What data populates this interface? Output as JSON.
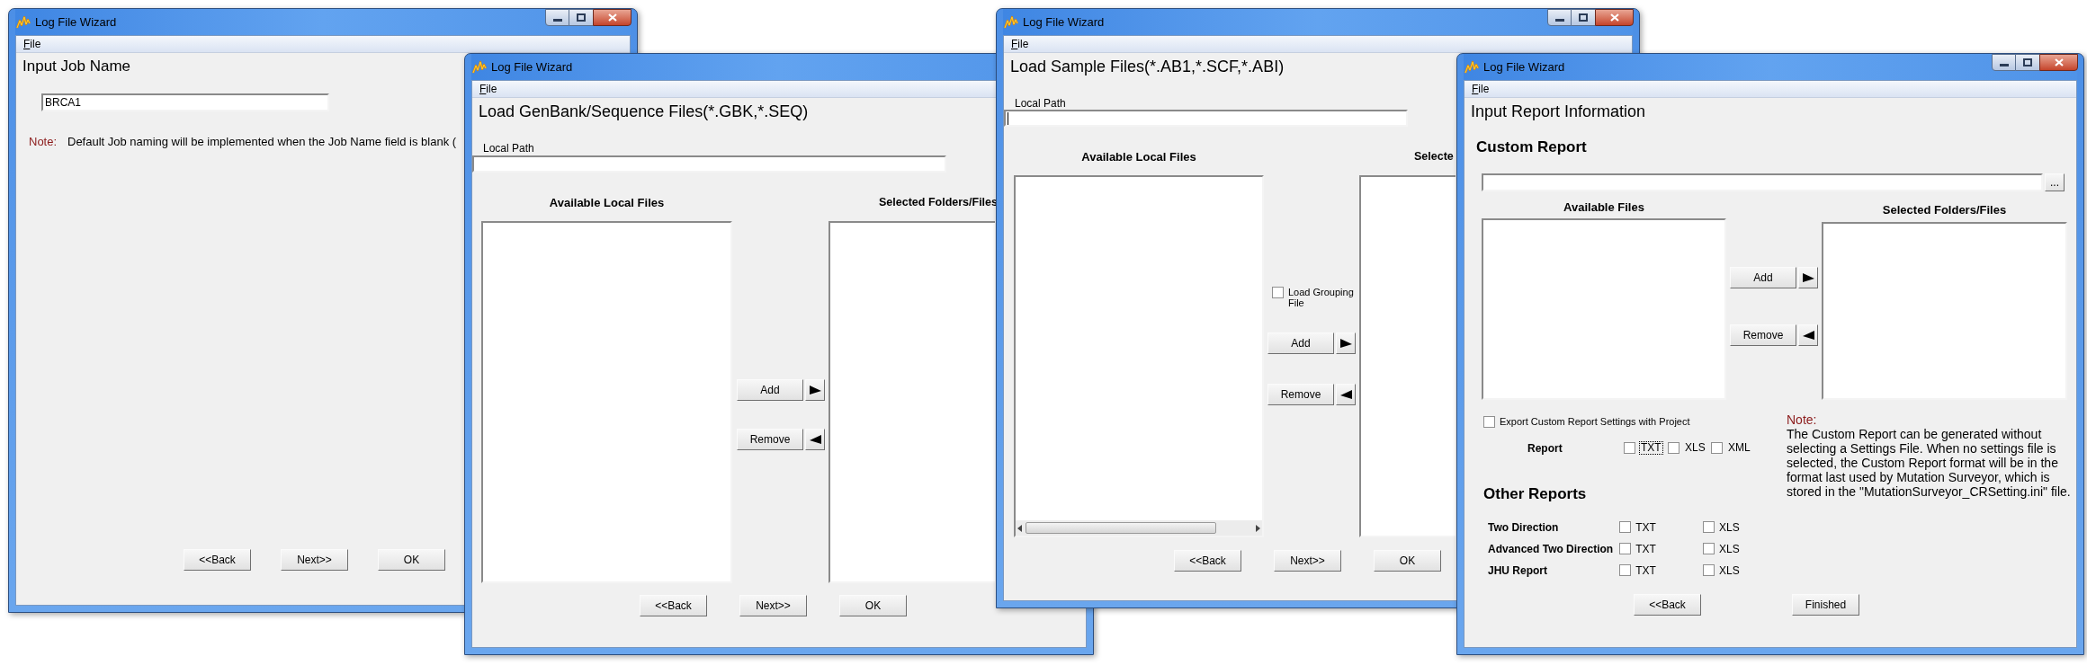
{
  "windows": [
    {
      "kind": "job_name",
      "title": "Log File Wizard",
      "menu": [
        "File"
      ],
      "heading": "Input Job Name",
      "job_name_field": {
        "value": "BRCA1"
      },
      "note": {
        "label": "Note:",
        "text": "Default Job naming will be implemented when the Job Name field is blank ("
      },
      "buttons": [
        "<<Back",
        "Next>>",
        "OK"
      ]
    },
    {
      "kind": "load_files",
      "title": "Log File Wizard",
      "menu": [
        "File"
      ],
      "heading": "Load GenBank/Sequence Files(*.GBK,*.SEQ)",
      "local_path": {
        "label": "Local Path",
        "focused": false
      },
      "available": {
        "header": "Available Local Files",
        "horizontal_scrollbar": false
      },
      "selected": {
        "header": "Selected Folders/Files"
      },
      "transfer_buttons": [
        "Add",
        "Remove"
      ],
      "buttons": [
        "<<Back",
        "Next>>",
        "OK"
      ]
    },
    {
      "kind": "load_files",
      "title": "Log File Wizard",
      "menu": [
        "File"
      ],
      "heading": "Load Sample Files(*.AB1,*.SCF,*.ABI)",
      "local_path": {
        "label": "Local Path",
        "focused": true
      },
      "available": {
        "header": "Available Local Files",
        "horizontal_scrollbar": true
      },
      "grouping_checkbox": {
        "label": "Load Grouping File",
        "checked": false
      },
      "selected": {
        "header": "Selecte"
      },
      "transfer_buttons": [
        "Add",
        "Remove"
      ],
      "buttons": [
        "<<Back",
        "Next>>",
        "OK"
      ]
    },
    {
      "kind": "report",
      "title": "Log File Wizard",
      "menu": [
        "File"
      ],
      "heading": "Input Report Information",
      "custom_report": {
        "title": "Custom Report",
        "browse_button": "..."
      },
      "available": {
        "header": "Available Files"
      },
      "selected": {
        "header": "Selected Folders/Files"
      },
      "transfer_buttons": [
        "Add",
        "Remove"
      ],
      "export_settings": {
        "label": "Export Custom Report Settings with Project",
        "checked": false
      },
      "report": {
        "label": "Report",
        "options": [
          {
            "label": "TXT",
            "checked": false,
            "focused": true
          },
          {
            "label": "XLS",
            "checked": false,
            "focused": false
          },
          {
            "label": "XML",
            "checked": false,
            "focused": false
          }
        ]
      },
      "other_reports": {
        "title": "Other Reports",
        "rows": [
          {
            "label": "Two Direction",
            "options": [
              {
                "label": "TXT",
                "checked": false
              },
              {
                "label": "XLS",
                "checked": false
              }
            ]
          },
          {
            "label": "Advanced Two Direction",
            "options": [
              {
                "label": "TXT",
                "checked": false
              },
              {
                "label": "XLS",
                "checked": false
              }
            ]
          },
          {
            "label": "JHU Report",
            "options": [
              {
                "label": "TXT",
                "checked": false
              },
              {
                "label": "XLS",
                "checked": false
              }
            ]
          }
        ]
      },
      "note": {
        "label": "Note:",
        "text": "The Custom Report can be generated without selecting a Settings File. When no settings file is selected, the Custom Report format will be in the format last used by Mutation Surveyor, which is stored in the \"MutationSurveyor_CRSetting.ini\" file."
      },
      "buttons": [
        "<<Back",
        "Finished"
      ]
    }
  ]
}
